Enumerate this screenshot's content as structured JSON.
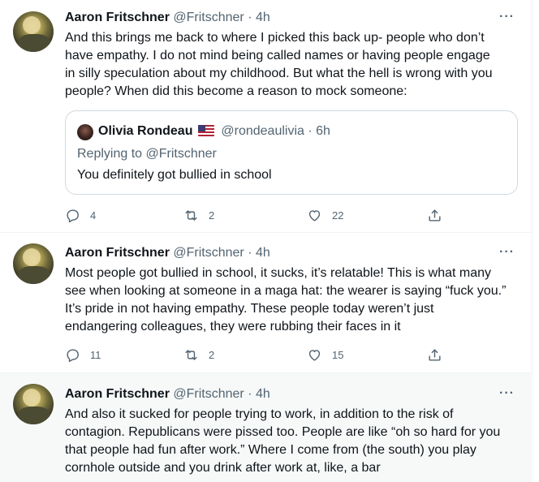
{
  "tweets": [
    {
      "author_name": "Aaron Fritschner",
      "meta": "@Fritschner · 4h",
      "more": "···",
      "text": [
        "And this brings me back to where I picked this back up- people who don’t",
        "have empathy. I do not mind being called names or having people engage",
        "in silly speculation about my childhood. But what the hell is wrong with you",
        "people? When did this become a reason to mock someone:"
      ],
      "quote": {
        "author_name": "Olivia Rondeau",
        "flag_icon": "us-flag-icon",
        "meta": "@rondeaulivia · 6h",
        "replying": "Replying to @Fritschner",
        "text": "You definitely got bullied in school"
      },
      "replies": "4",
      "retweets": "2",
      "likes": "22"
    },
    {
      "author_name": "Aaron Fritschner",
      "meta": "@Fritschner · 4h",
      "more": "···",
      "text": [
        "Most people got bullied in school, it sucks, it’s relatable! This is what many",
        "see when looking at someone in a maga hat: the wearer is saying “fuck you.”",
        "It’s pride in not having empathy. These people today weren’t just",
        "endangering colleagues, they were rubbing their faces in it"
      ],
      "replies": "11",
      "retweets": "2",
      "likes": "15"
    },
    {
      "author_name": "Aaron Fritschner",
      "meta": "@Fritschner · 4h",
      "more": "···",
      "text": [
        "And also it sucked for people trying to work, in addition to the risk of",
        "contagion. Republicans were pissed too. People are like “oh so hard for you",
        "that people had fun after work.” Where I come from (the south) you play",
        "cornhole outside and you drink after work at, like, a bar"
      ]
    }
  ],
  "icons": {
    "reply": "reply-icon",
    "retweet": "retweet-icon",
    "like": "heart-icon",
    "share": "share-icon"
  },
  "colors": {
    "text": "#0f1419",
    "secondary": "#536471",
    "border": "#eff3f4",
    "highlight_bg": "#f7f9f9"
  }
}
